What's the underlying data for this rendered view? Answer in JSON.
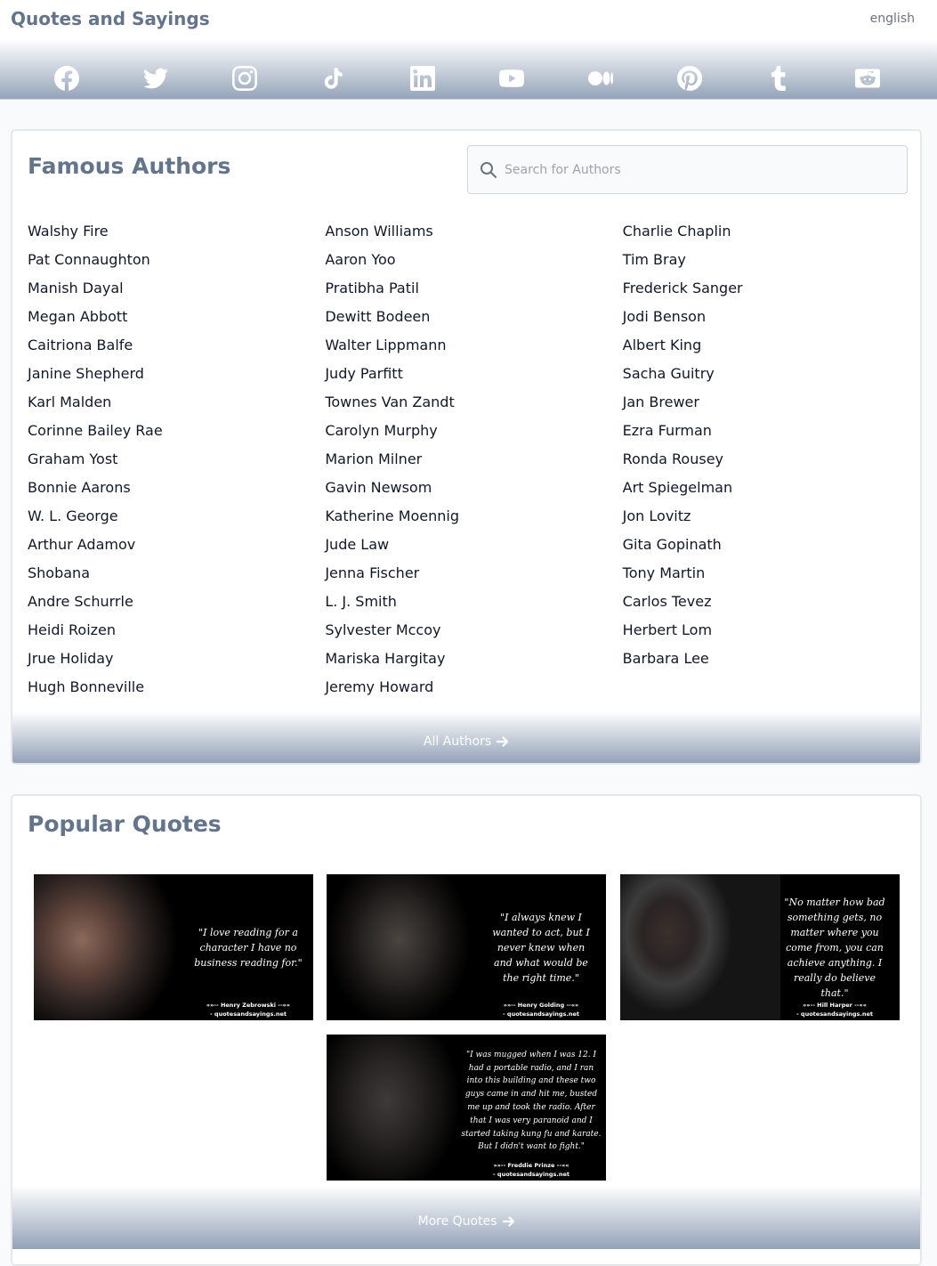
{
  "header": {
    "site_title": "Quotes and Sayings",
    "language": "english",
    "social_icons": [
      "facebook-icon",
      "twitter-icon",
      "instagram-icon",
      "tiktok-icon",
      "linkedin-icon",
      "youtube-icon",
      "medium-icon",
      "pinterest-icon",
      "tumblr-icon",
      "reddit-icon"
    ]
  },
  "authors": {
    "title": "Famous Authors",
    "search_placeholder": "Search for Authors",
    "columns": [
      [
        "Walshy Fire",
        "Pat Connaughton",
        "Manish Dayal",
        "Megan Abbott",
        "Caitriona Balfe",
        "Janine Shepherd",
        "Karl Malden",
        "Corinne Bailey Rae",
        "Graham Yost",
        "Bonnie Aarons",
        "W. L. George",
        "Arthur Adamov",
        "Shobana",
        "Andre Schurrle",
        "Heidi Roizen",
        "Jrue Holiday",
        "Hugh Bonneville"
      ],
      [
        "Anson Williams",
        "Aaron Yoo",
        "Pratibha Patil",
        "Dewitt Bodeen",
        "Walter Lippmann",
        "Judy Parfitt",
        "Townes Van Zandt",
        "Carolyn Murphy",
        "Marion Milner",
        "Gavin Newsom",
        "Katherine Moennig",
        "Jude Law",
        "Jenna Fischer",
        "L. J. Smith",
        "Sylvester Mccoy",
        "Mariska Hargitay",
        "Jeremy Howard"
      ],
      [
        "Charlie Chaplin",
        "Tim Bray",
        "Frederick Sanger",
        "Jodi Benson",
        "Albert King",
        "Sacha Guitry",
        "Jan Brewer",
        "Ezra Furman",
        "Ronda Rousey",
        "Art Spiegelman",
        "Jon Lovitz",
        "Gita Gopinath",
        "Tony Martin",
        "Carlos Tevez",
        "Herbert Lom",
        "Barbara Lee"
      ]
    ],
    "all_link": "All Authors"
  },
  "quotes": {
    "title": "Popular Quotes",
    "more_link": "More Quotes",
    "items": [
      {
        "text": "\"I love reading for a character I have no business reading for.\"",
        "author": "»»-- Henry Zebrowski --««",
        "site": "- quotesandsayings.net"
      },
      {
        "text": "\"I always knew I wanted to act, but I never knew when and what would be the right time.\"",
        "author": "»»-- Henry Golding --««",
        "site": "- quotesandsayings.net"
      },
      {
        "text": "\"No matter how bad something gets, no matter where you come from, you can achieve anything. I really do believe that.\"",
        "author": "»»-- Hill Harper --««",
        "site": "- quotesandsayings.net"
      },
      {
        "text": "\"I was mugged when I was 12. I had a portable radio, and I ran into this building and these two guys came in and hit me, busted me up and took the radio. After that I was very paranoid and I started taking kung fu and karate. But I didn't want to fight.\"",
        "author": "»»-- Freddie Prinze --««",
        "site": "- quotesandsayings.net"
      }
    ]
  }
}
